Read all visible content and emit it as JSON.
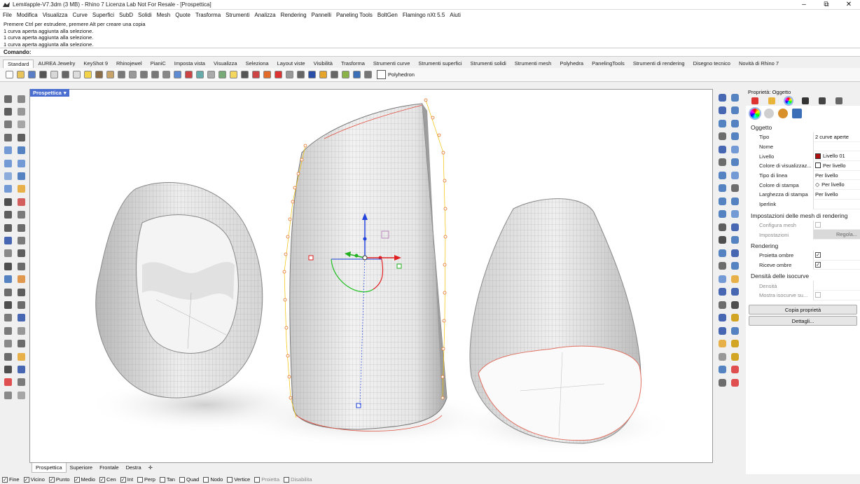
{
  "window": {
    "title": "Lem#apple-V7.3dm (3 MB) - Rhino 7 Licenza Lab Not For Resale - [Prospettica]",
    "restore_glyph": "⧉"
  },
  "menu": [
    "File",
    "Modifica",
    "Visualizza",
    "Curve",
    "Superfici",
    "SubD",
    "Solidi",
    "Mesh",
    "Quote",
    "Trasforma",
    "Strumenti",
    "Analizza",
    "Rendering",
    "Pannelli",
    "Paneling Tools",
    "BoltGen",
    "Flamingo nXt 5.5",
    "Aiuti"
  ],
  "command_history": [
    "Premere Ctrl per estrudere, premere Alt per creare una copia",
    "1 curva aperta aggiunta alla selezione.",
    "1 curva aperta aggiunta alla selezione.",
    "1 curva aperta aggiunta alla selezione."
  ],
  "command_prompt": "Comando:",
  "toolbar_tabs": [
    "Standard",
    "AUREA Jewelry",
    "KeyShot 9",
    "Rhinojewel",
    "PianiC",
    "Imposta vista",
    "Visualizza",
    "Seleziona",
    "Layout viste",
    "Visibilità",
    "Trasforma",
    "Strumenti curve",
    "Strumenti superfici",
    "Strumenti solidi",
    "Strumenti mesh",
    "Polyhedra",
    "PanelingTools",
    "Strumenti di rendering",
    "Disegno tecnico",
    "Novità di Rhino 7"
  ],
  "active_tab": "Standard",
  "toolbar_icon_colors": [
    "#ffffff",
    "#e8c45a",
    "#5a7fc6",
    "#555555",
    "#d8d8d8",
    "#666666",
    "#dddddd",
    "#f3d34a",
    "#8a6b4a",
    "#c9a46a",
    "#7a7a7a",
    "#999999",
    "#7a7a7a",
    "#777777",
    "#888888",
    "#5e8bd1",
    "#c44",
    "#6aa",
    "#aaa",
    "#7a7",
    "#f5d760",
    "#555",
    "#c44",
    "#e36b2a",
    "#d33",
    "#999",
    "#666",
    "#2a4fa8",
    "#e6a52a",
    "#666",
    "#8cb34a",
    "#3b6fb8",
    "#777"
  ],
  "polyhedron_label": "Polyhedron",
  "viewport": {
    "label": "Prospettica",
    "tabs": [
      "Prospettica",
      "Superiore",
      "Frontale",
      "Destra"
    ],
    "active": "Prospettica",
    "add_glyph": "✛"
  },
  "osnaps": [
    {
      "label": "Fine",
      "checked": true
    },
    {
      "label": "Vicino",
      "checked": true
    },
    {
      "label": "Punto",
      "checked": true
    },
    {
      "label": "Medio",
      "checked": true
    },
    {
      "label": "Cen",
      "checked": true
    },
    {
      "label": "Int",
      "checked": true
    },
    {
      "label": "Perp",
      "checked": false
    },
    {
      "label": "Tan",
      "checked": false
    },
    {
      "label": "Quad",
      "checked": false
    },
    {
      "label": "Nodo",
      "checked": false
    },
    {
      "label": "Vertice",
      "checked": false
    },
    {
      "label": "Proietta",
      "checked": false,
      "disabled": true
    },
    {
      "label": "Disabilita",
      "checked": false,
      "disabled": true
    }
  ],
  "properties": {
    "header": "Proprietà: Oggetto",
    "section_object": "Oggetto",
    "rows": [
      {
        "k": "Tipo",
        "v": "2 curve aperte"
      },
      {
        "k": "Nome",
        "v": ""
      },
      {
        "k": "Livello",
        "v": "Livello 01",
        "swatch": "#b01010"
      },
      {
        "k": "Colore di visualizzaz...",
        "v": "Per livello",
        "swatch": "#ffffff"
      },
      {
        "k": "Tipo di linea",
        "v": "Per livello"
      },
      {
        "k": "Colore di stampa",
        "v": "Per livello",
        "diamond": true
      },
      {
        "k": "Larghezza di stampa",
        "v": "Per livello"
      },
      {
        "k": "Iperlink",
        "v": ""
      }
    ],
    "section_mesh": "Impostazioni delle mesh di rendering",
    "mesh_rows": [
      {
        "k": "Configura mesh"
      },
      {
        "k": "Impostazioni",
        "btn": "Regola..."
      }
    ],
    "section_render": "Rendering",
    "render_rows": [
      {
        "k": "Proietta ombre",
        "checked": true
      },
      {
        "k": "Riceve ombre",
        "checked": true
      }
    ],
    "section_iso": "Densità delle isocurve",
    "iso_rows": [
      {
        "k": "Densità"
      },
      {
        "k": "Mostra isocurve su..."
      }
    ],
    "copy_btn": "Copia proprietà",
    "details_btn": "Dettagli..."
  }
}
